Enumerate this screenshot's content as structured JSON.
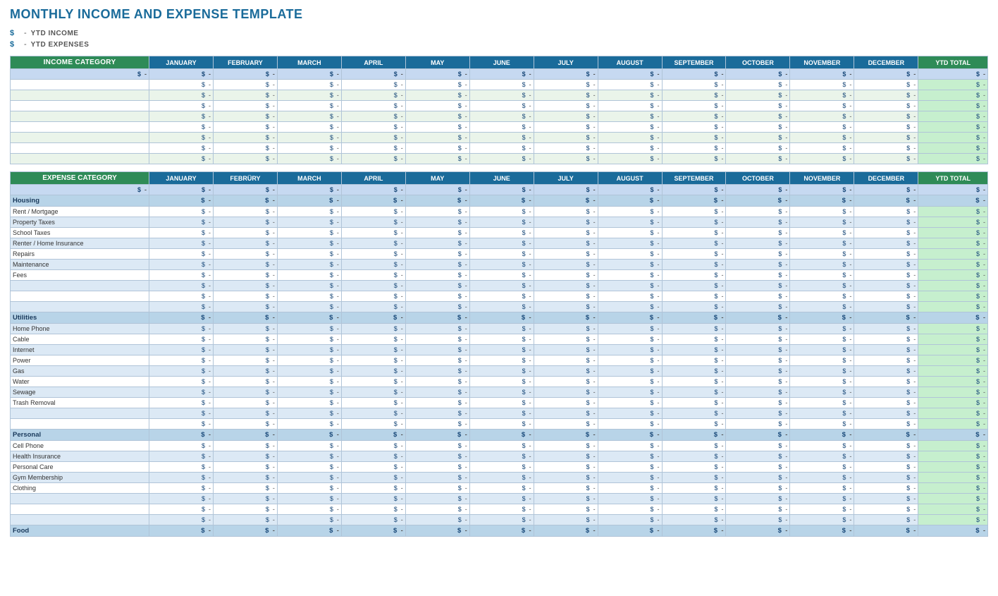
{
  "title": "MONTHLY INCOME AND EXPENSE TEMPLATE",
  "ytd_income_label": "YTD INCOME",
  "ytd_expenses_label": "YTD EXPENSES",
  "dollar_sign": "$",
  "dash": "-",
  "months": [
    "JANUARY",
    "FEBRUARY",
    "MARCH",
    "APRIL",
    "MAY",
    "JUNE",
    "JULY",
    "AUGUST",
    "SEPTEMBER",
    "OCTOBER",
    "NOVEMBER",
    "DECEMBER"
  ],
  "ytd_total_label": "YTD TOTAL",
  "income_category_label": "INCOME CATEGORY",
  "expense_category_label": "EXPENSE CATEGORY",
  "income_rows": 8,
  "expense_groups": [
    {
      "name": "Housing",
      "items": [
        "Rent / Mortgage",
        "Property Taxes",
        "School Taxes",
        "Renter / Home Insurance",
        "Repairs",
        "Maintenance",
        "Fees",
        "",
        "",
        ""
      ]
    },
    {
      "name": "Utilities",
      "items": [
        "Home Phone",
        "Cable",
        "Internet",
        "Power",
        "Gas",
        "Water",
        "Sewage",
        "Trash Removal",
        "",
        ""
      ]
    },
    {
      "name": "Personal",
      "items": [
        "Cell Phone",
        "Health Insurance",
        "Personal Care",
        "Gym Membership",
        "Clothing",
        "",
        "",
        ""
      ]
    }
  ],
  "food_label": "Food"
}
